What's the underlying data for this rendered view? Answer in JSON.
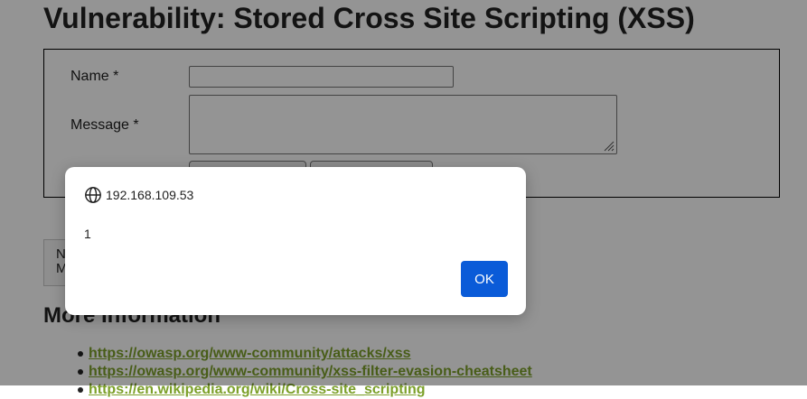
{
  "page": {
    "title": "Vulnerability: Stored Cross Site Scripting (XSS)"
  },
  "form": {
    "name_label": "Name *",
    "name_value": "",
    "message_label": "Message *",
    "message_value": "",
    "sign_button_label": "",
    "clear_button_label": ""
  },
  "guestbook": {
    "line1": "N",
    "line2": "M"
  },
  "more_info": {
    "title": "More Information",
    "links": [
      "https://owasp.org/www-community/attacks/xss",
      "https://owasp.org/www-community/xss-filter-evasion-cheatsheet",
      "https://en.wikipedia.org/wiki/Cross-site_scripting"
    ]
  },
  "dialog": {
    "origin": "192.168.109.53",
    "message": "1",
    "ok_label": "OK",
    "origin_icon": "globe-icon"
  },
  "colors": {
    "link": "#7ca02a",
    "ok_button": "#0a5bd8",
    "overlay": "rgba(0,0,0,0.42)"
  }
}
